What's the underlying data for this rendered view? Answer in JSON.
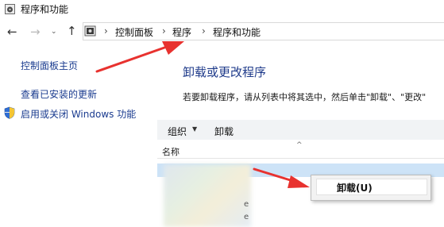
{
  "window": {
    "title": "程序和功能"
  },
  "nav": {
    "back_icon": "back-arrow",
    "forward_icon": "forward-arrow",
    "recent_icon": "chevron-down",
    "up_icon": "up-arrow"
  },
  "address_bar": {
    "breadcrumbs": [
      "控制面板",
      "程序",
      "程序和功能"
    ]
  },
  "sidebar": {
    "items": [
      {
        "label": "控制面板主页"
      },
      {
        "label": "查看已安装的更新"
      },
      {
        "label": "启用或关闭 Windows 功能",
        "icon": "shield"
      }
    ]
  },
  "main": {
    "heading": "卸载或更改程序",
    "description": "若要卸载程序，请从列表中将其选中，然后单击\"卸载\"、\"更改\"",
    "toolbar": {
      "organize": "组织",
      "uninstall": "卸载"
    },
    "columns": {
      "name": "名称"
    }
  },
  "context_menu": {
    "uninstall": "卸载(U)"
  },
  "colors": {
    "annotation_red": "#e8322f",
    "link_blue": "#1a3b8f",
    "heading_blue": "#1e3a8a",
    "selection": "#cde3f7"
  }
}
